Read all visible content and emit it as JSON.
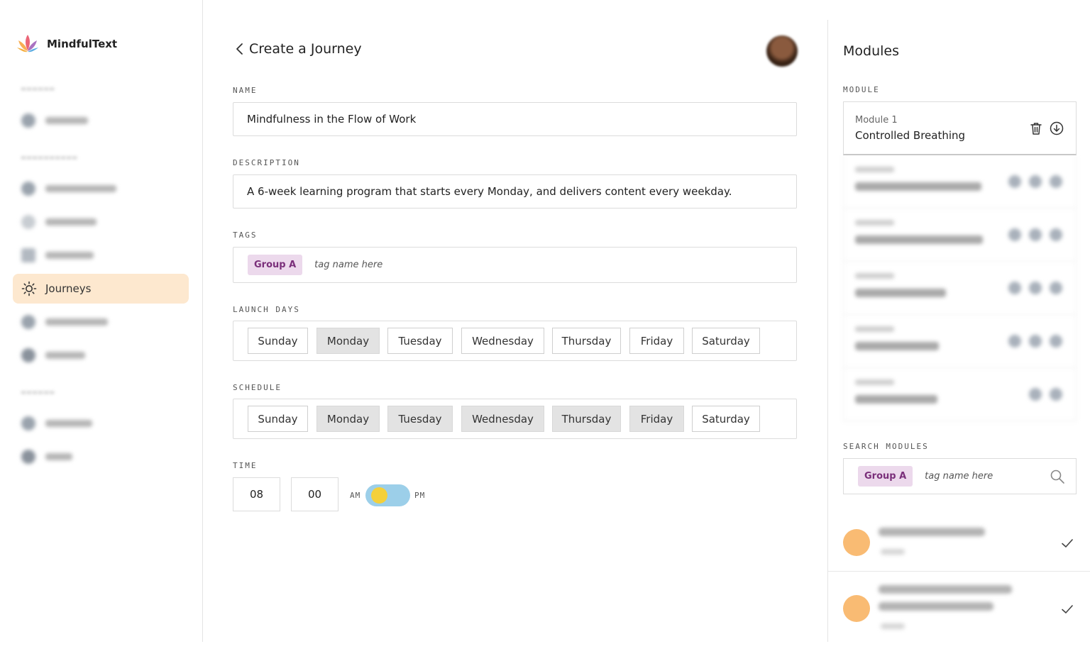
{
  "app": {
    "name": "MindfulText"
  },
  "sidebar": {
    "active_item": {
      "label": "Journeys",
      "icon": "sun-icon"
    }
  },
  "header": {
    "title": "Create a Journey"
  },
  "form": {
    "name": {
      "label": "NAME",
      "value": "Mindfulness in the Flow of Work"
    },
    "description": {
      "label": "DESCRIPTION",
      "value": "A 6-week learning program that starts every Monday, and delivers content every weekday."
    },
    "tags": {
      "label": "TAGS",
      "chips": [
        "Group A"
      ],
      "placeholder": "tag name here"
    },
    "launch_days": {
      "label": "LAUNCH DAYS",
      "days": [
        "Sunday",
        "Monday",
        "Tuesday",
        "Wednesday",
        "Thursday",
        "Friday",
        "Saturday"
      ],
      "selected": [
        "Monday"
      ]
    },
    "schedule": {
      "label": "SCHEDULE",
      "days": [
        "Sunday",
        "Monday",
        "Tuesday",
        "Wednesday",
        "Thursday",
        "Friday",
        "Saturday"
      ],
      "selected": [
        "Monday",
        "Tuesday",
        "Wednesday",
        "Thursday",
        "Friday"
      ]
    },
    "time": {
      "label": "TIME",
      "hour": "08",
      "minute": "00",
      "am_label": "AM",
      "pm_label": "PM",
      "period": "AM"
    }
  },
  "modules_panel": {
    "title": "Modules",
    "module_label": "MODULE",
    "current_module": {
      "number": "Module 1",
      "title": "Controlled Breathing"
    },
    "search": {
      "label": "SEARCH MODULES",
      "chip": "Group A",
      "placeholder": "tag name here"
    }
  },
  "colors": {
    "active_nav_bg": "#fde8cf",
    "tag_chip_bg": "#ecd9ec",
    "tag_chip_text": "#7a2f7a",
    "toggle_track": "#9ccfe9",
    "toggle_knob": "#f4d03a",
    "result_avatar": "#f9bb73",
    "selected_day_bg": "#e3e3e3"
  }
}
